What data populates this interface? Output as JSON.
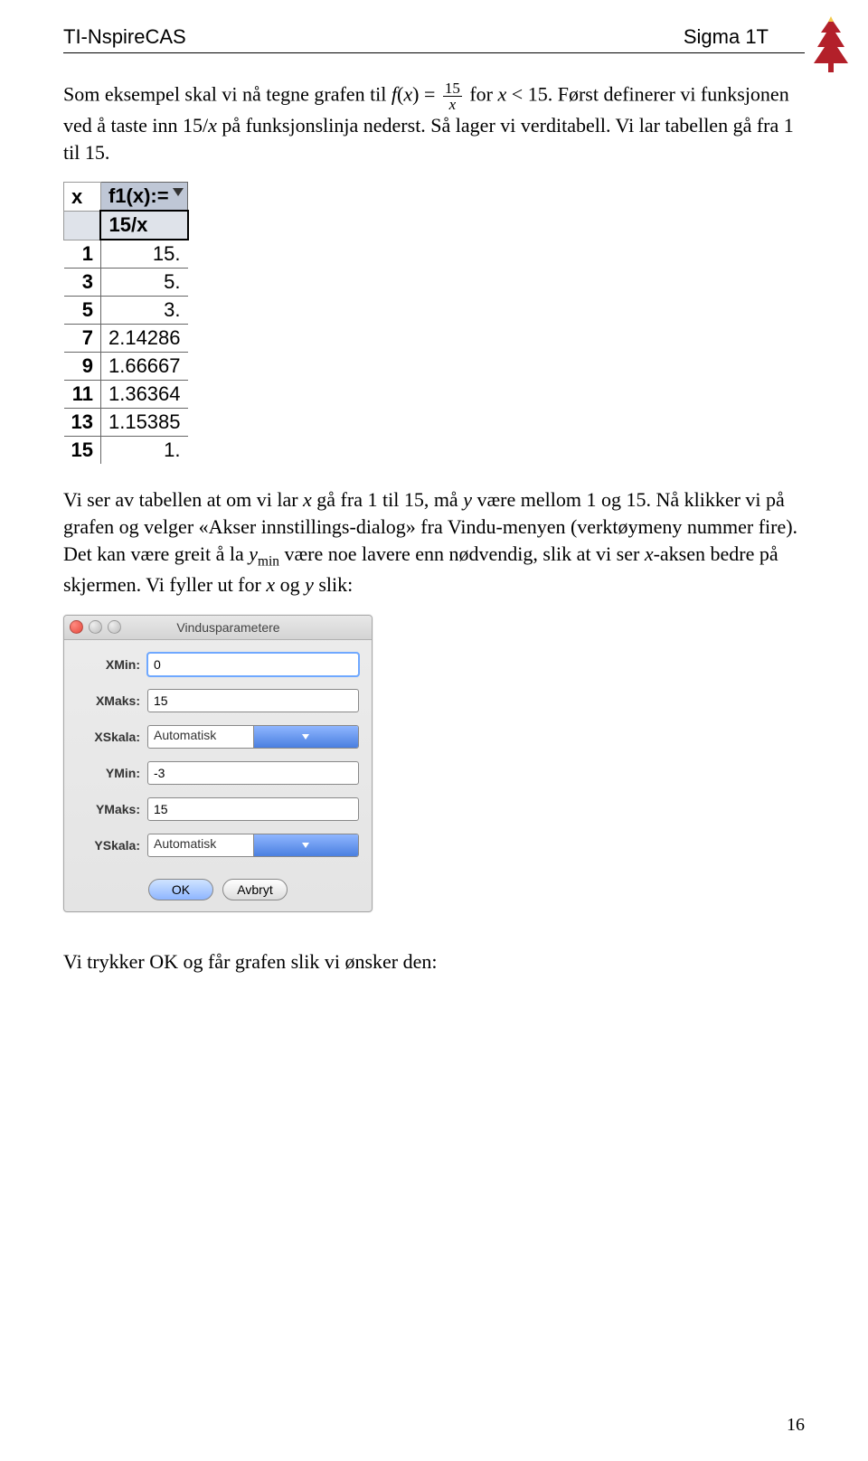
{
  "header": {
    "left": "TI-NspireCAS",
    "right": "Sigma 1T"
  },
  "para1_a": "Som eksempel skal vi nå tegne grafen til ",
  "para1_b": " for ",
  "para1_c": ". Først definerer vi funksjonen ved å taste inn 15/",
  "para1_d": " på funksjonslinja nederst. Så lager vi verditabell. Vi lar tabellen gå fra 1 til 15.",
  "fx": "f",
  "x": "x",
  "eq": "(",
  "eq2": ") = ",
  "fnum": "15",
  "fden": "x",
  "lt": " < 15",
  "sheet": {
    "colA_header": "x",
    "colB_header": "f1(x):=",
    "formula": "15/x",
    "rows": [
      {
        "a": "1",
        "b": "15."
      },
      {
        "a": "3",
        "b": "5."
      },
      {
        "a": "5",
        "b": "3."
      },
      {
        "a": "7",
        "b": "2.14286"
      },
      {
        "a": "9",
        "b": "1.66667"
      },
      {
        "a": "11",
        "b": "1.36364"
      },
      {
        "a": "13",
        "b": "1.15385"
      },
      {
        "a": "15",
        "b": "1."
      }
    ]
  },
  "para2_a": "Vi ser av tabellen at om vi lar ",
  "para2_b": " gå fra 1 til 15, må ",
  "para2_c": " være mellom 1 og 15. Nå klikker vi på grafen og velger «Akser innstillings-dialog» fra Vindu-menyen (verktøymeny nummer fire). Det kan være greit å la ",
  "para2_d": " være noe lavere enn nødvendig, slik at vi ser ",
  "para2_e": "-aksen bedre på skjermen. Vi fyller ut for ",
  "para2_f": " og ",
  "para2_g": " slik:",
  "y": "y",
  "ymin": "y",
  "ymin_sub": "min",
  "dialog": {
    "title": "Vindusparametere",
    "xmin_label": "XMin:",
    "xmin": "0",
    "xmax_label": "XMaks:",
    "xmax": "15",
    "xscale_label": "XSkala:",
    "xscale": "Automatisk",
    "ymin_label": "YMin:",
    "ymin": "-3",
    "ymax_label": "YMaks:",
    "ymax": "15",
    "yscale_label": "YSkala:",
    "yscale": "Automatisk",
    "ok": "OK",
    "cancel": "Avbryt"
  },
  "para3": "Vi trykker OK og får grafen slik vi ønsker den:",
  "pagenum": "16"
}
